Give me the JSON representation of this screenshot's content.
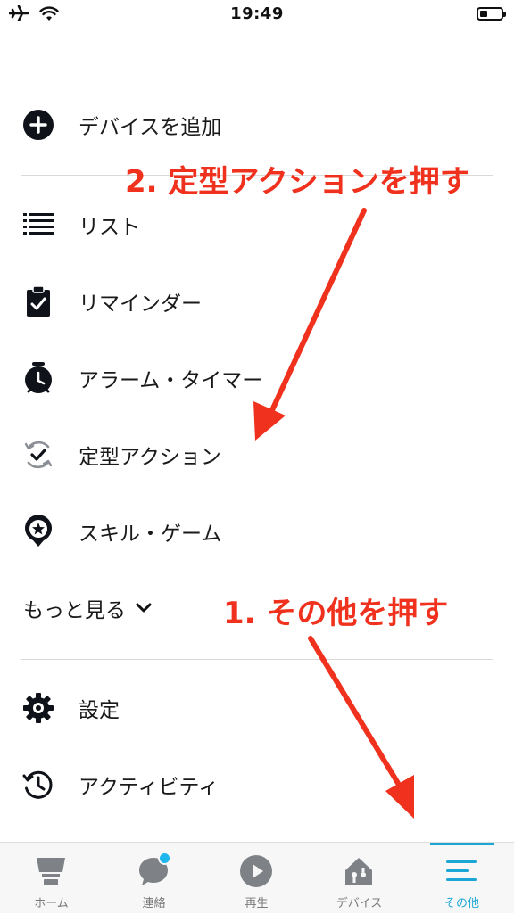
{
  "status_bar": {
    "time": "19:49"
  },
  "menu": {
    "add_device": "デバイスを追加",
    "items": [
      {
        "label": "リスト",
        "icon": "list-icon"
      },
      {
        "label": "リマインダー",
        "icon": "clipboard-check-icon"
      },
      {
        "label": "アラーム・タイマー",
        "icon": "alarm-clock-icon"
      },
      {
        "label": "定型アクション",
        "icon": "routine-check-icon"
      },
      {
        "label": "スキル・ゲーム",
        "icon": "skill-star-icon"
      }
    ],
    "see_more": "もっと見る",
    "settings": "設定",
    "activity": "アクティビティ"
  },
  "annotations": {
    "step2": "2. 定型アクションを押す",
    "step1": "1. その他を押す",
    "color": "#f0311d"
  },
  "tabbar": {
    "tabs": [
      {
        "label": "ホーム",
        "icon": "home-icon"
      },
      {
        "label": "連絡",
        "icon": "chat-bubble-icon"
      },
      {
        "label": "再生",
        "icon": "play-icon"
      },
      {
        "label": "デバイス",
        "icon": "devices-icon"
      },
      {
        "label": "その他",
        "icon": "menu-lines-icon"
      }
    ],
    "active_color": "#1ba6d6"
  }
}
